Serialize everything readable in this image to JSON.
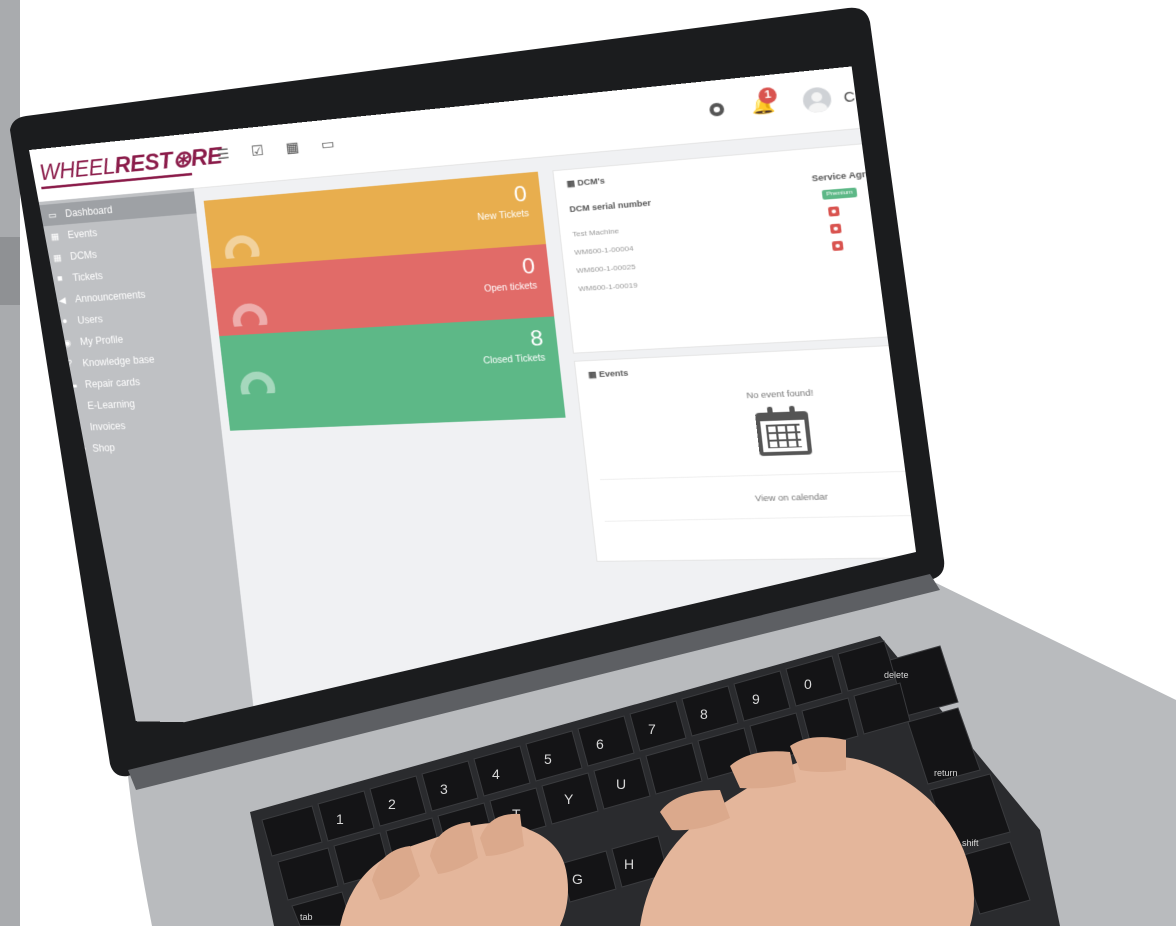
{
  "logo": {
    "part1": "WHEEL",
    "part2": "REST",
    "part3": "RE"
  },
  "toolbar_icons": [
    "list-icon",
    "checkbox-icon",
    "grid-icon",
    "monitor-icon"
  ],
  "header": {
    "notifications_count": "1",
    "user_name": "Customer Doe ▾"
  },
  "sidebar": {
    "items": [
      {
        "label": "Dashboard",
        "icon": "monitor-icon"
      },
      {
        "label": "Events",
        "icon": "calendar-icon"
      },
      {
        "label": "DCMs",
        "icon": "grid-icon"
      },
      {
        "label": "Tickets",
        "icon": "ticket-icon"
      },
      {
        "label": "Announcements",
        "icon": "megaphone-icon"
      },
      {
        "label": "Users",
        "icon": "user-icon"
      },
      {
        "label": "My Profile",
        "icon": "user-circle-icon"
      },
      {
        "label": "Knowledge base",
        "icon": "question-icon"
      },
      {
        "label": "Repair cards",
        "icon": "folder-icon"
      },
      {
        "label": "E-Learning",
        "icon": "graduation-icon"
      },
      {
        "label": "Invoices",
        "icon": "file-icon"
      },
      {
        "label": "Shop",
        "icon": "cart-icon"
      }
    ]
  },
  "stats": [
    {
      "value": "0",
      "label": "New Tickets",
      "color": "#e8ae4e"
    },
    {
      "value": "0",
      "label": "Open tickets",
      "color": "#e16b68"
    },
    {
      "value": "8",
      "label": "Closed Tickets",
      "color": "#5db887"
    }
  ],
  "dcm_panel": {
    "title": "DCM's",
    "col_serial": "DCM serial number",
    "col_sa": "Service Agreement",
    "rows": [
      "Test Machine",
      "WM600-1-00004",
      "WM600-1-00025",
      "WM600-1-00019"
    ],
    "sa_first": "Premium"
  },
  "events_panel": {
    "title": "Events",
    "empty_text": "No event found!",
    "view_calendar": "View on calendar"
  },
  "keyboard": {
    "keys": [
      "delete",
      "return",
      "shift",
      "tab"
    ]
  },
  "colors": {
    "brand": "#8b1c4a",
    "sidebar": "#bfc1c4",
    "orange": "#e8ae4e",
    "red": "#e16b68",
    "green": "#5db887"
  }
}
